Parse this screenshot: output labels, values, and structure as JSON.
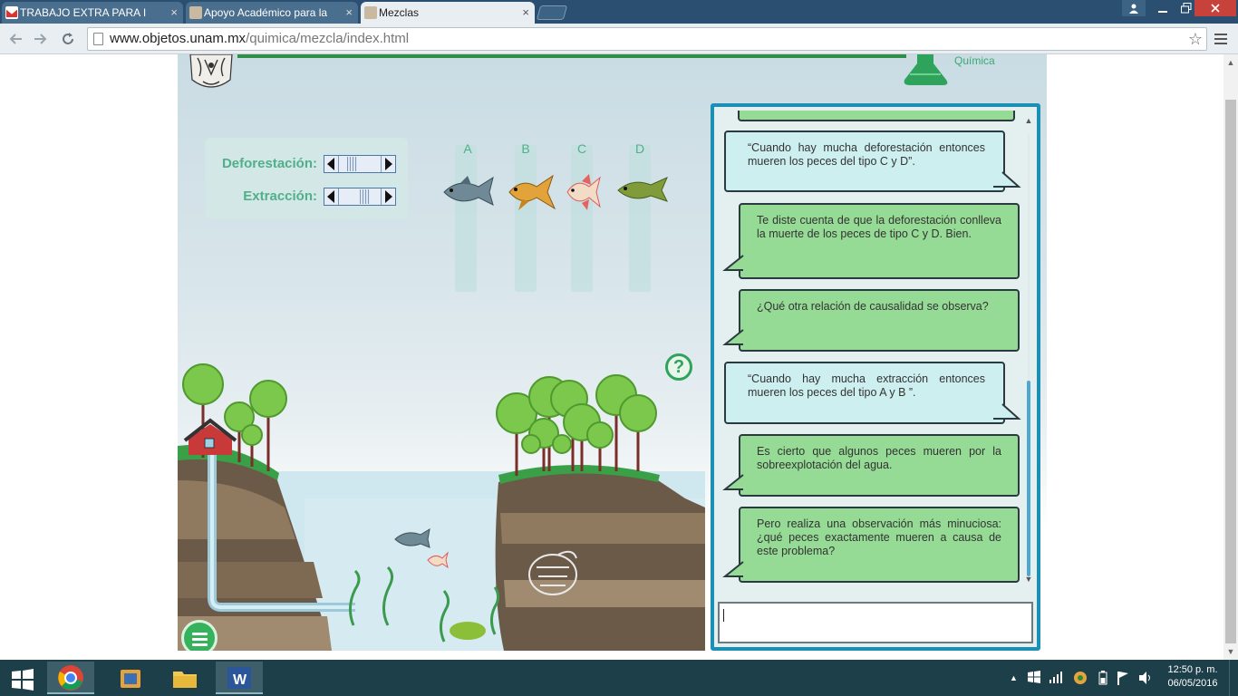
{
  "browser": {
    "tabs": [
      {
        "title": "TRABAJO EXTRA PARA IN",
        "favicon": "gmail-icon",
        "active": false
      },
      {
        "title": "Apoyo Académico para la",
        "favicon": "unam-icon",
        "active": false
      },
      {
        "title": "Mezclas",
        "favicon": "unam-icon",
        "active": true
      }
    ],
    "url_host": "www.objetos.unam.mx",
    "url_path": "/quimica/mezcla/index.html",
    "close_glyph": "×"
  },
  "app": {
    "header_label": "Química",
    "sliders": [
      {
        "label": "Deforestación:",
        "level": 0.25
      },
      {
        "label": "Extracción:",
        "level": 0.65
      }
    ],
    "fish_columns": [
      "A",
      "B",
      "C",
      "D"
    ],
    "help_label": "?"
  },
  "chat": {
    "messages": [
      {
        "role": "user",
        "text": "“Cuando hay mucha deforestación entonces mueren los peces del tipo C y D”."
      },
      {
        "role": "bot",
        "text": "Te diste cuenta de que la deforestación conlleva la muerte de los peces de tipo C y D. Bien."
      },
      {
        "role": "bot",
        "text": "¿Qué otra relación de causalidad se observa?"
      },
      {
        "role": "user",
        "text": "“Cuando hay mucha extracción entonces mueren los peces del tipo A y B ”."
      },
      {
        "role": "bot",
        "text": "Es cierto que algunos peces mueren por la sobreexplotación del agua."
      },
      {
        "role": "bot",
        "text": "Pero realiza una observación más minuciosa: ¿qué peces exactamente mueren a causa de este problema?"
      }
    ],
    "input_value": ""
  },
  "taskbar": {
    "time": "12:50 p. m.",
    "date": "06/05/2016"
  },
  "colors": {
    "accent_green": "#4fb08a",
    "chat_border": "#1c8fb5",
    "bot_bubble": "#95db95",
    "user_bubble": "#cdeff0"
  }
}
